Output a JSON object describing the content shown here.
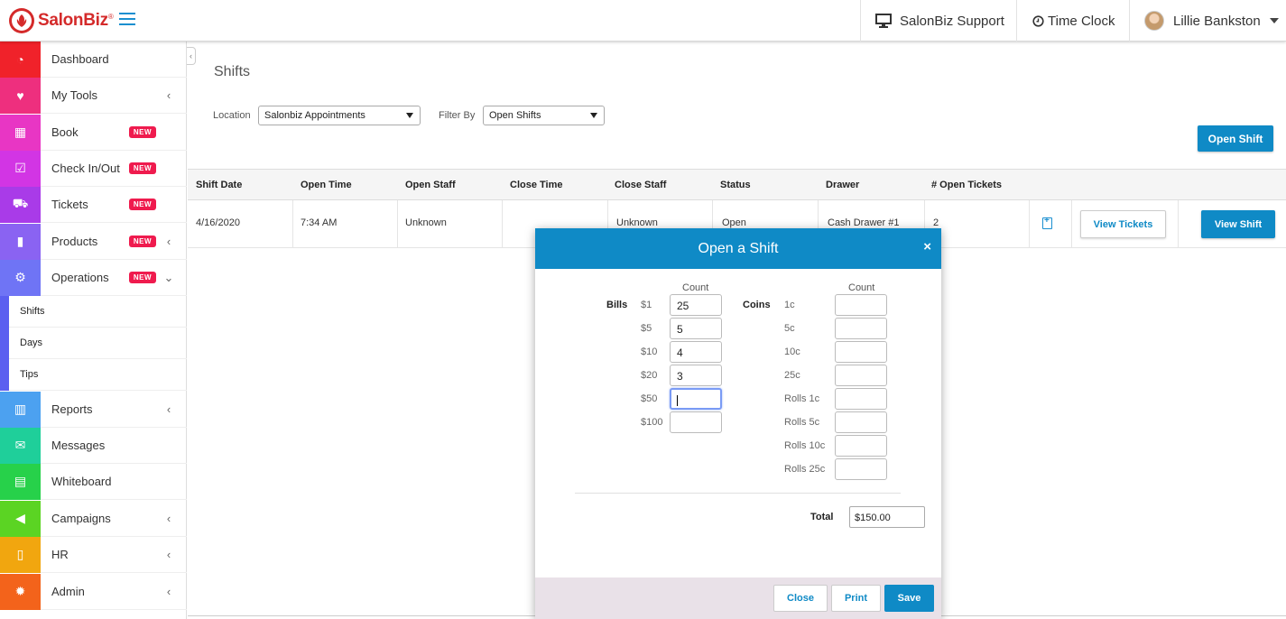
{
  "app": {
    "logo_text": "SalonBiz",
    "logo_reg": "®"
  },
  "topbar": {
    "support": "SalonBiz Support",
    "timeclock": "Time Clock",
    "user": "Lillie Bankston"
  },
  "sidebar": {
    "items": [
      {
        "label": "Dashboard",
        "color": "#f0222a",
        "icon": "dashboard-icon",
        "glyph": "◔"
      },
      {
        "label": "My Tools",
        "color": "#ee2f7e",
        "icon": "heartbeat-icon",
        "glyph": "♥",
        "chev": "‹"
      },
      {
        "label": "Book",
        "color": "#e836c4",
        "icon": "calendar-icon",
        "glyph": "▦",
        "badge": "NEW"
      },
      {
        "label": "Check In/Out",
        "color": "#d235e4",
        "icon": "calendar-check-icon",
        "glyph": "☑",
        "badge": "NEW"
      },
      {
        "label": "Tickets",
        "color": "#a93be8",
        "icon": "cart-icon",
        "glyph": "⛟",
        "badge": "NEW"
      },
      {
        "label": "Products",
        "color": "#8a63f2",
        "icon": "bottles-icon",
        "glyph": "▮",
        "badge": "NEW",
        "chev": "‹"
      },
      {
        "label": "Operations",
        "color": "#6f74f5",
        "icon": "gears-icon",
        "glyph": "⚙",
        "badge": "NEW",
        "chev": "⌄"
      },
      {
        "label": "Reports",
        "color": "#4ca1f0",
        "icon": "bar-chart-icon",
        "glyph": "▥",
        "chev": "‹"
      },
      {
        "label": "Messages",
        "color": "#1fcf9a",
        "icon": "envelope-icon",
        "glyph": "✉"
      },
      {
        "label": "Whiteboard",
        "color": "#27d14a",
        "icon": "whiteboard-icon",
        "glyph": "▤"
      },
      {
        "label": "Campaigns",
        "color": "#5bd423",
        "icon": "megaphone-icon",
        "glyph": "◀",
        "chev": "‹"
      },
      {
        "label": "HR",
        "color": "#f1a60f",
        "icon": "document-icon",
        "glyph": "▯",
        "chev": "‹"
      },
      {
        "label": "Admin",
        "color": "#f3631b",
        "icon": "cog-icon",
        "glyph": "✹",
        "chev": "‹"
      }
    ],
    "sub_items": [
      "Shifts",
      "Days",
      "Tips"
    ]
  },
  "page": {
    "title": "Shifts",
    "location_label": "Location",
    "location_value": "Salonbiz Appointments",
    "filter_label": "Filter By",
    "filter_value": "Open Shifts",
    "open_shift_button": "Open Shift"
  },
  "table": {
    "headers": [
      "Shift Date",
      "Open Time",
      "Open Staff",
      "Close Time",
      "Close Staff",
      "Status",
      "Drawer",
      "# Open Tickets"
    ],
    "rows": [
      {
        "cells": [
          "4/16/2020",
          "7:34 AM",
          "Unknown",
          "",
          "Unknown",
          "Open",
          "Cash Drawer #1",
          "2"
        ],
        "view_tickets": "View Tickets",
        "view_shift": "View Shift"
      }
    ]
  },
  "modal": {
    "title": "Open a Shift",
    "close_glyph": "×",
    "count_header": "Count",
    "bills_label": "Bills",
    "coins_label": "Coins",
    "bills": [
      {
        "label": "$1",
        "value": "25"
      },
      {
        "label": "$5",
        "value": "5"
      },
      {
        "label": "$10",
        "value": "4"
      },
      {
        "label": "$20",
        "value": "3"
      },
      {
        "label": "$50",
        "value": ""
      },
      {
        "label": "$100",
        "value": ""
      }
    ],
    "coins": [
      {
        "label": "1c",
        "value": ""
      },
      {
        "label": "5c",
        "value": ""
      },
      {
        "label": "10c",
        "value": ""
      },
      {
        "label": "25c",
        "value": ""
      },
      {
        "label": "Rolls 1c",
        "value": ""
      },
      {
        "label": "Rolls 5c",
        "value": ""
      },
      {
        "label": "Rolls 10c",
        "value": ""
      },
      {
        "label": "Rolls 25c",
        "value": ""
      }
    ],
    "total_label": "Total",
    "total_value": "$150.00",
    "buttons": {
      "close": "Close",
      "print": "Print",
      "save": "Save"
    }
  }
}
